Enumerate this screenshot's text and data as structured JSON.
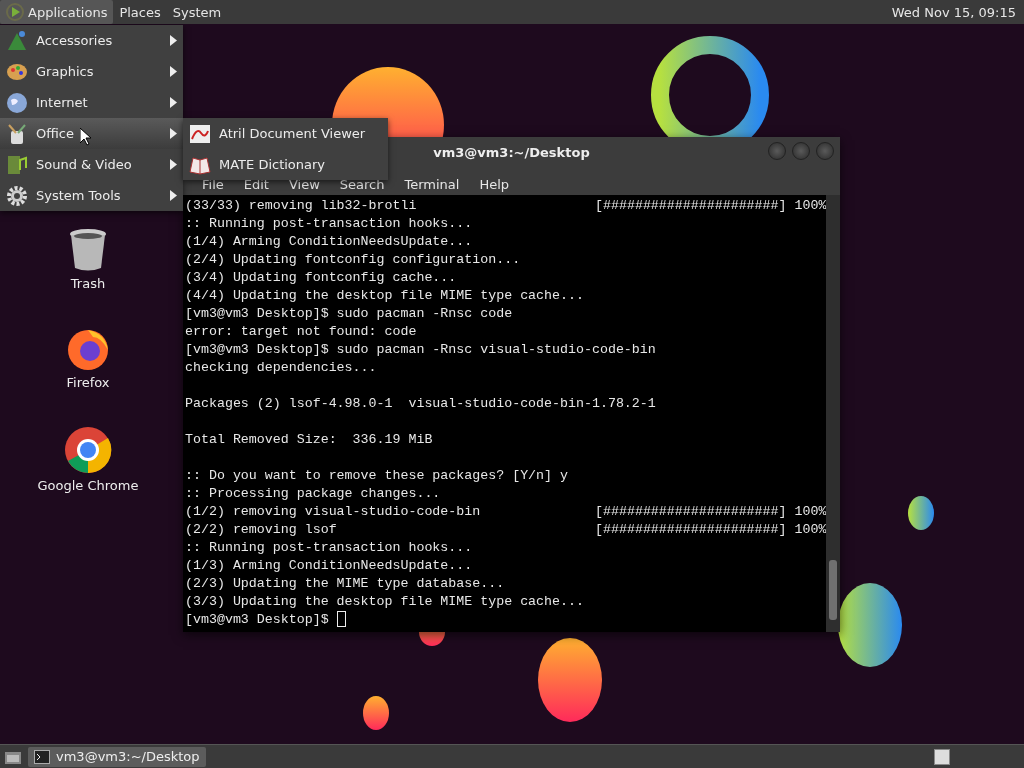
{
  "top_panel": {
    "menus": [
      {
        "label": "Applications",
        "selected": true
      },
      {
        "label": "Places",
        "selected": false
      },
      {
        "label": "System",
        "selected": false
      }
    ],
    "clock": "Wed Nov 15, 09:15"
  },
  "applications_menu": {
    "items": [
      {
        "label": "Accessories",
        "selected": false
      },
      {
        "label": "Graphics",
        "selected": false
      },
      {
        "label": "Internet",
        "selected": false
      },
      {
        "label": "Office",
        "selected": true
      },
      {
        "label": "Sound & Video",
        "selected": false
      },
      {
        "label": "System Tools",
        "selected": false
      }
    ]
  },
  "office_submenu": {
    "items": [
      {
        "label": "Atril Document Viewer"
      },
      {
        "label": "MATE Dictionary"
      }
    ]
  },
  "desktop_icons": [
    {
      "label": "Trash"
    },
    {
      "label": "Firefox"
    },
    {
      "label": "Google Chrome"
    }
  ],
  "terminal": {
    "title": "vm3@vm3:~/Desktop",
    "menu": [
      "File",
      "Edit",
      "View",
      "Search",
      "Terminal",
      "Help"
    ],
    "blocks": [
      {
        "lines": [
          {
            "text": "(33/33) removing lib32-brotli",
            "right": "[######################] 100%"
          },
          {
            "text": ":: Running post-transaction hooks..."
          },
          {
            "text": "(1/4) Arming ConditionNeedsUpdate..."
          },
          {
            "text": "(2/4) Updating fontconfig configuration..."
          },
          {
            "text": "(3/4) Updating fontconfig cache..."
          },
          {
            "text": "(4/4) Updating the desktop file MIME type cache..."
          },
          {
            "text": "[vm3@vm3 Desktop]$ sudo pacman -Rnsc code"
          },
          {
            "text": "error: target not found: code"
          },
          {
            "text": "[vm3@vm3 Desktop]$ sudo pacman -Rnsc visual-studio-code-bin"
          },
          {
            "text": "checking dependencies..."
          }
        ]
      },
      {
        "lines": [
          {
            "text": "Packages (2) lsof-4.98.0-1  visual-studio-code-bin-1.78.2-1"
          }
        ]
      },
      {
        "lines": [
          {
            "text": "Total Removed Size:  336.19 MiB"
          }
        ]
      },
      {
        "lines": [
          {
            "text": ":: Do you want to remove these packages? [Y/n] y"
          },
          {
            "text": ":: Processing package changes..."
          },
          {
            "text": "(1/2) removing visual-studio-code-bin",
            "right": "[######################] 100%"
          },
          {
            "text": "(2/2) removing lsof",
            "right": "[######################] 100%"
          },
          {
            "text": ":: Running post-transaction hooks..."
          },
          {
            "text": "(1/3) Arming ConditionNeedsUpdate..."
          },
          {
            "text": "(2/3) Updating the MIME type database..."
          },
          {
            "text": "(3/3) Updating the desktop file MIME type cache..."
          },
          {
            "text": "[vm3@vm3 Desktop]$ ",
            "cursor": true
          }
        ]
      }
    ]
  },
  "taskbar": {
    "tasks": [
      {
        "label": "vm3@vm3:~/Desktop",
        "selected": true
      }
    ]
  }
}
